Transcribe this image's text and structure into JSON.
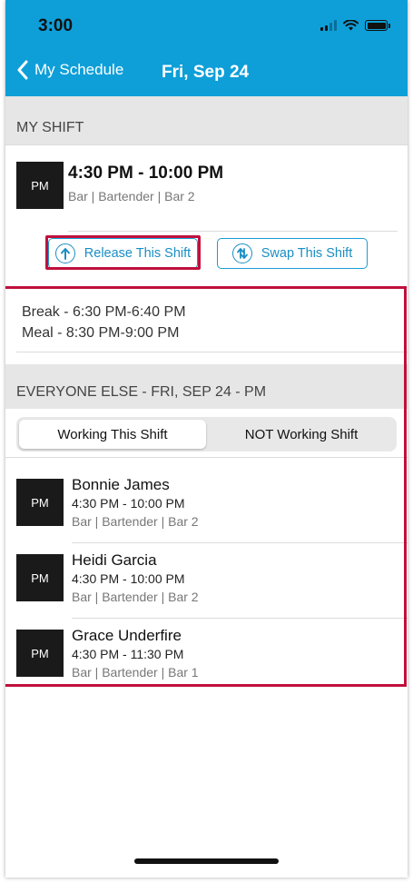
{
  "status_bar": {
    "time": "3:00"
  },
  "nav": {
    "back_label": "My Schedule",
    "title": "Fri, Sep 24"
  },
  "my_shift": {
    "section_title": "MY SHIFT",
    "avatar": "PM",
    "time": "4:30 PM - 10:00 PM",
    "role": "Bar | Bartender | Bar 2",
    "release_label": "Release This Shift",
    "swap_label": "Swap This Shift"
  },
  "breaks": [
    "Break - 6:30 PM-6:40 PM",
    "Meal - 8:30 PM-9:00 PM"
  ],
  "everyone_else": {
    "section_title": "EVERYONE ELSE - FRI, SEP 24 - PM",
    "tabs": [
      "Working This Shift",
      "NOT Working Shift"
    ],
    "active_tab": "Working This Shift",
    "people": [
      {
        "avatar": "PM",
        "name": "Bonnie James",
        "time": "4:30 PM - 10:00 PM",
        "role": "Bar | Bartender | Bar 2"
      },
      {
        "avatar": "PM",
        "name": "Heidi Garcia",
        "time": "4:30 PM - 10:00 PM",
        "role": "Bar | Bartender | Bar 2"
      },
      {
        "avatar": "PM",
        "name": "Grace Underfire",
        "time": "4:30 PM - 11:30 PM",
        "role": "Bar | Bartender | Bar 1"
      }
    ]
  },
  "colors": {
    "header": "#0e9fd8",
    "accent": "#1a8ec4",
    "highlight": "#c0103c"
  },
  "icons": [
    "chevron-left-icon",
    "signal-icon",
    "wifi-icon",
    "battery-icon",
    "release-arrow-icon",
    "swap-arrows-icon"
  ]
}
